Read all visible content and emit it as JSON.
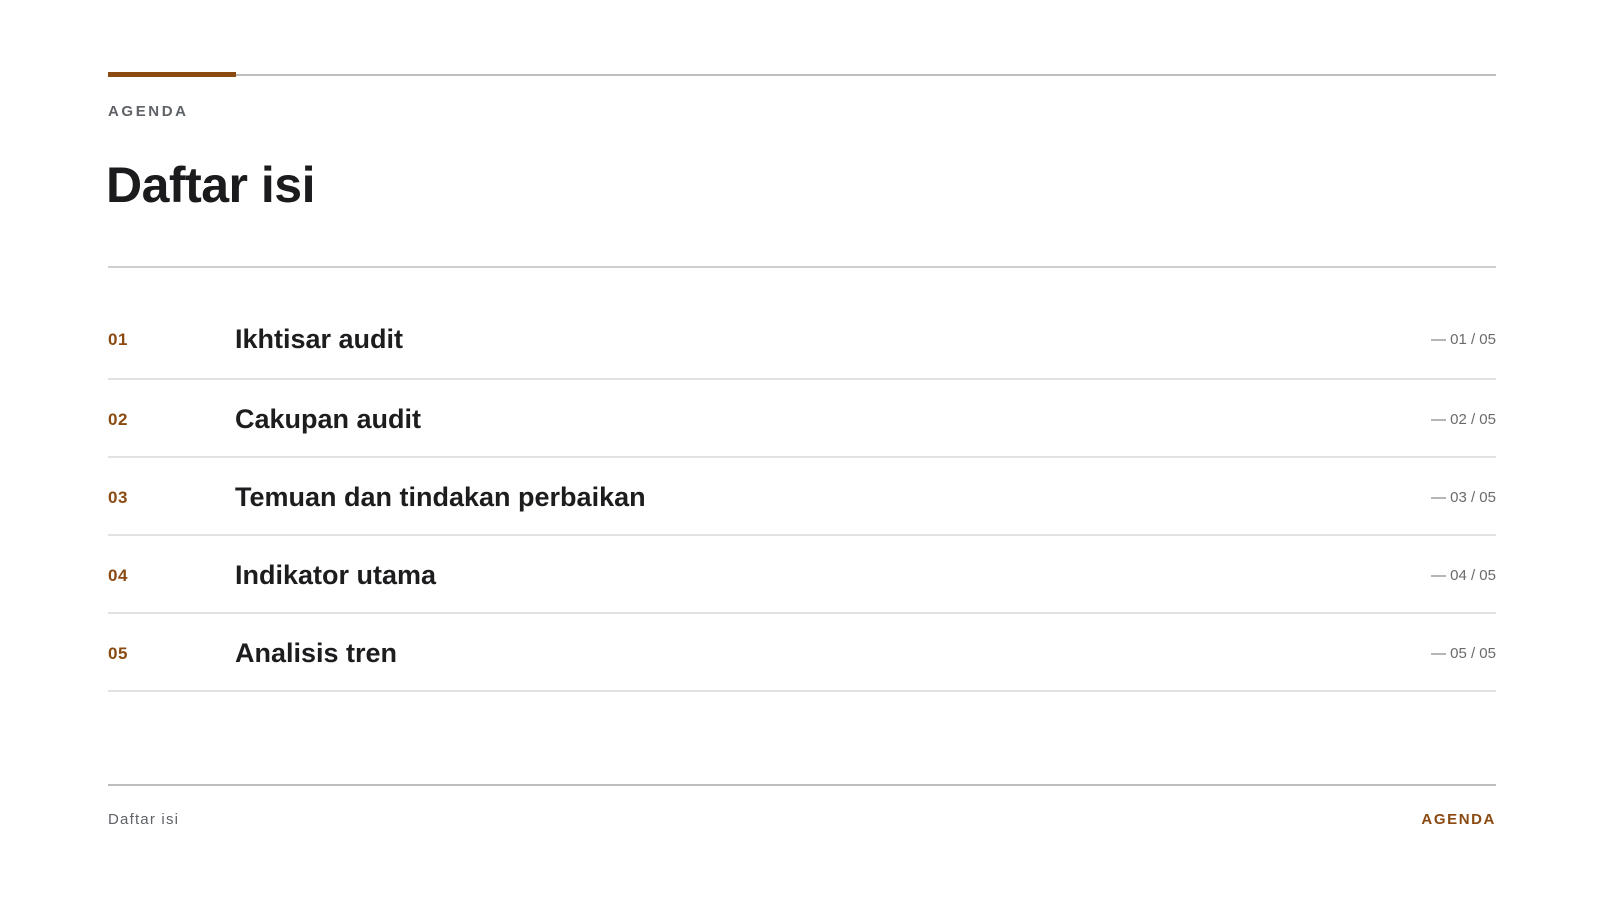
{
  "header": {
    "eyebrow": "AGENDA",
    "title": "Daftar isi"
  },
  "agenda": {
    "items": [
      {
        "num": "01",
        "label": "Ikhtisar audit",
        "page": "— 01 / 05"
      },
      {
        "num": "02",
        "label": "Cakupan audit",
        "page": "— 02 / 05"
      },
      {
        "num": "03",
        "label": "Temuan dan tindakan perbaikan",
        "page": "— 03 / 05"
      },
      {
        "num": "04",
        "label": "Indikator utama",
        "page": "— 04 / 05"
      },
      {
        "num": "05",
        "label": "Analisis tren",
        "page": "— 05 / 05"
      }
    ]
  },
  "footer": {
    "left": "Daftar isi",
    "right": "AGENDA"
  },
  "colors": {
    "accent": "#8a4a12",
    "text": "#1d1d1f",
    "muted": "#5f6368",
    "rule": "#bdbdbd"
  }
}
